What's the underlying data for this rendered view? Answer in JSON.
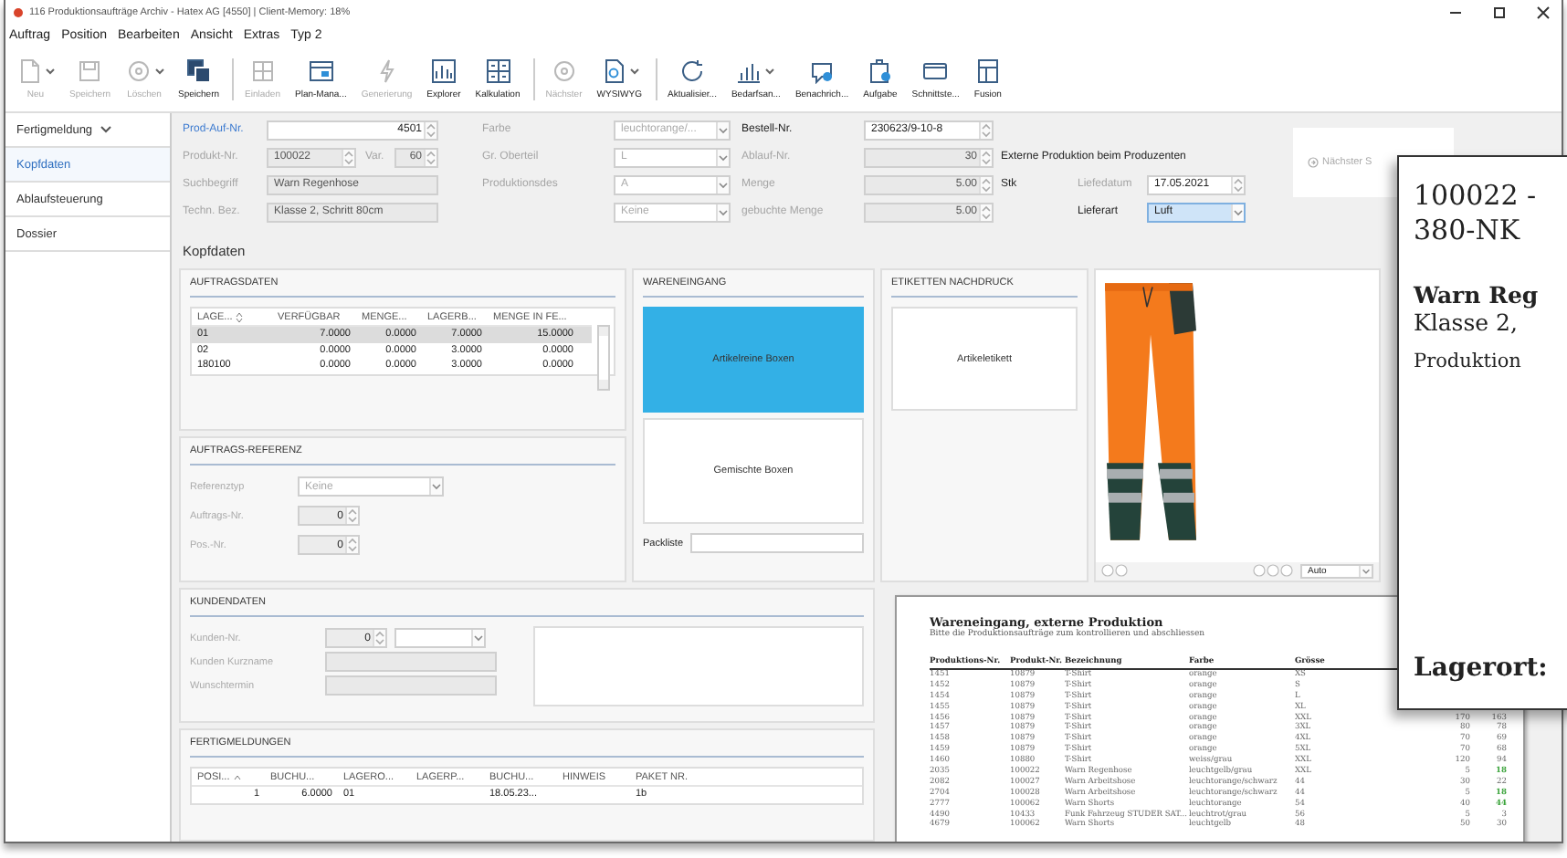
{
  "window": {
    "title": "116 Produktionsaufträge Archiv - Hatex AG [4550] | Client-Memory: 18%"
  },
  "menu": [
    "Auftrag",
    "Position",
    "Bearbeiten",
    "Ansicht",
    "Extras",
    "Typ 2"
  ],
  "toolbar": [
    {
      "label": "Neu",
      "kind": "document",
      "disabled": true,
      "dropdown": true,
      "group_start": false
    },
    {
      "label": "Speichern",
      "kind": "disk",
      "disabled": true,
      "dropdown": false,
      "group_start": false
    },
    {
      "label": "Löschen",
      "kind": "circle",
      "disabled": true,
      "dropdown": true,
      "group_start": false
    },
    {
      "label": "Speichern",
      "kind": "disks",
      "disabled": false,
      "dropdown": false,
      "group_start": false
    },
    {
      "label": "Einladen",
      "kind": "grid",
      "disabled": true,
      "dropdown": false,
      "group_start": true
    },
    {
      "label": "Plan-Mana...",
      "kind": "window",
      "disabled": false,
      "dropdown": false,
      "group_start": false
    },
    {
      "label": "Generierung",
      "kind": "bolt",
      "disabled": true,
      "dropdown": false,
      "group_start": false
    },
    {
      "label": "Explorer",
      "kind": "chart",
      "disabled": false,
      "dropdown": false,
      "group_start": false
    },
    {
      "label": "Kalkulation",
      "kind": "calculator",
      "disabled": false,
      "dropdown": false,
      "group_start": false
    },
    {
      "label": "Nächster",
      "kind": "circle",
      "disabled": true,
      "dropdown": false,
      "group_start": true
    },
    {
      "label": "WYSIWYG",
      "kind": "magnifier",
      "disabled": false,
      "dropdown": true,
      "group_start": false
    },
    {
      "label": "Aktualisier...",
      "kind": "refresh",
      "disabled": false,
      "dropdown": false,
      "group_start": true
    },
    {
      "label": "Bedarfsan...",
      "kind": "bars",
      "disabled": false,
      "dropdown": true,
      "group_start": false
    },
    {
      "label": "Benachrich...",
      "kind": "bubble",
      "disabled": false,
      "dropdown": false,
      "group_start": false
    },
    {
      "label": "Aufgabe",
      "kind": "clipboard",
      "disabled": false,
      "dropdown": false,
      "group_start": false
    },
    {
      "label": "Schnittste...",
      "kind": "card",
      "disabled": false,
      "dropdown": false,
      "group_start": false
    },
    {
      "label": "Fusion",
      "kind": "table",
      "disabled": false,
      "dropdown": false,
      "group_start": false
    }
  ],
  "sidebar": {
    "dropdown": "Fertigmeldung",
    "items": [
      {
        "label": "Kopfdaten",
        "selected": true
      },
      {
        "label": "Ablaufsteuerung",
        "selected": false
      },
      {
        "label": "Dossier",
        "selected": false
      }
    ]
  },
  "header": {
    "rows": [
      {
        "columns": [
          [
            {
              "kind": "link",
              "text": "Prod-Auf-Nr."
            },
            {
              "kind": "spin",
              "text": "4501",
              "numeric": true,
              "disabled": false,
              "readonly": false,
              "focused": false
            }
          ],
          [
            {
              "kind": "label",
              "text": "Farbe",
              "disabled": true
            },
            {
              "kind": "select",
              "text": "leuchtorange/...",
              "numeric": false,
              "disabled": true,
              "readonly": false,
              "focused": false
            }
          ],
          [
            {
              "kind": "label",
              "text": "Bestell-Nr.",
              "disabled": false
            },
            {
              "kind": "spin",
              "text": "230623/9-10-8",
              "numeric": false,
              "disabled": false,
              "readonly": false,
              "focused": false
            }
          ]
        ]
      },
      {
        "columns": [
          [
            {
              "kind": "label",
              "text": "Produkt-Nr.",
              "disabled": true
            },
            {
              "kind": "spin",
              "text": "100022",
              "numeric": false,
              "disabled": false,
              "readonly": true,
              "focused": false
            },
            {
              "kind": "label-short",
              "text": "Var.",
              "disabled": true
            },
            {
              "kind": "spin-narrow",
              "text": "60",
              "numeric": true,
              "disabled": false,
              "readonly": true,
              "focused": false
            }
          ],
          [
            {
              "kind": "label",
              "text": "Gr. Oberteil",
              "disabled": true
            },
            {
              "kind": "select",
              "text": "L",
              "numeric": false,
              "disabled": true,
              "readonly": false,
              "focused": false
            }
          ],
          [
            {
              "kind": "label",
              "text": "Ablauf-Nr.",
              "disabled": true
            },
            {
              "kind": "spin",
              "text": "30",
              "numeric": true,
              "disabled": false,
              "readonly": true,
              "focused": false
            }
          ],
          [
            {
              "kind": "text",
              "text": "Externe Produktion beim Produzenten"
            }
          ]
        ]
      },
      {
        "columns": [
          [
            {
              "kind": "label",
              "text": "Suchbegriff",
              "disabled": true
            },
            {
              "kind": "input",
              "text": "Warn Regenhose",
              "numeric": false,
              "disabled": false,
              "readonly": true,
              "focused": false
            }
          ],
          [
            {
              "kind": "label",
              "text": "Produktionsdes",
              "disabled": true
            },
            {
              "kind": "select",
              "text": "A",
              "numeric": false,
              "disabled": true,
              "readonly": false,
              "focused": false
            }
          ],
          [
            {
              "kind": "label",
              "text": "Menge",
              "disabled": true
            },
            {
              "kind": "spin",
              "text": "5.00",
              "numeric": true,
              "disabled": false,
              "readonly": true,
              "focused": false
            }
          ],
          [
            {
              "kind": "unit",
              "text": "Stk"
            },
            {
              "kind": "label",
              "text": "Liefedatum",
              "disabled": true
            },
            {
              "kind": "spin",
              "text": "17.05.2021",
              "numeric": false,
              "disabled": false,
              "readonly": false,
              "focused": false
            }
          ]
        ]
      },
      {
        "columns": [
          [
            {
              "kind": "label",
              "text": "Techn. Bez.",
              "disabled": true
            },
            {
              "kind": "input",
              "text": "Klasse 2, Schritt 80cm",
              "numeric": false,
              "disabled": false,
              "readonly": true,
              "focused": false
            }
          ],
          [
            {
              "kind": "select",
              "text": "Keine",
              "numeric": false,
              "disabled": true,
              "readonly": false,
              "focused": false
            }
          ],
          [
            {
              "kind": "label",
              "text": "gebuchte Menge",
              "disabled": true
            },
            {
              "kind": "spin",
              "text": "5.00",
              "numeric": true,
              "disabled": false,
              "readonly": true,
              "focused": false
            }
          ],
          [
            {
              "kind": "label",
              "text": "Lieferart",
              "disabled": false
            },
            {
              "kind": "select",
              "text": "Luft",
              "numeric": false,
              "disabled": false,
              "readonly": false,
              "focused": true
            }
          ]
        ]
      }
    ],
    "next_button": {
      "label": "Nächster S",
      "disabled": true
    }
  },
  "section_title": "Kopfdaten",
  "auftragsdaten": {
    "title": "AUFTRAGSDATEN",
    "columns": [
      {
        "label": "LAGE...",
        "sortable": true
      },
      {
        "label": "VERFÜGBAR"
      },
      {
        "label": "MENGE..."
      },
      {
        "label": "LAGERB..."
      },
      {
        "label": "MENGE IN FE..."
      }
    ],
    "rows": [
      {
        "cells": [
          "01",
          "7.0000",
          "0.0000",
          "7.0000",
          "15.0000"
        ],
        "selected": true
      },
      {
        "cells": [
          "02",
          "0.0000",
          "0.0000",
          "3.0000",
          "0.0000"
        ],
        "selected": false
      },
      {
        "cells": [
          "180100",
          "0.0000",
          "0.0000",
          "3.0000",
          "0.0000"
        ],
        "selected": false
      }
    ]
  },
  "wareneingang": {
    "title": "WARENEINGANG",
    "buttons": [
      {
        "label": "Artikelreine Boxen",
        "selected": true
      },
      {
        "label": "Gemischte Boxen",
        "selected": false
      }
    ],
    "packliste_label": "Packliste"
  },
  "etiketten": {
    "title": "ETIKETTEN NACHDRUCK",
    "button": "Artikeletikett"
  },
  "image_panel": {
    "kind": "picture",
    "zoom_mode": "Auto"
  },
  "auftrags_referenz": {
    "title": "AUFTRAGS-REFERENZ",
    "rows": [
      {
        "label": "Referenztyp",
        "fields": [
          {
            "kind": "select",
            "text": "Keine"
          }
        ]
      },
      {
        "label": "Auftrags-Nr.",
        "fields": [
          {
            "kind": "spin",
            "text": "0"
          }
        ]
      },
      {
        "label": "Pos.-Nr.",
        "fields": [
          {
            "kind": "spin",
            "text": "0"
          }
        ]
      }
    ]
  },
  "kundendaten": {
    "title": "KUNDENDATEN",
    "rows": [
      {
        "label": "Kunden-Nr.",
        "fields": [
          {
            "kind": "spin",
            "text": "0"
          },
          {
            "kind": "select"
          }
        ]
      },
      {
        "label": "Kunden Kurzname",
        "fields": [
          {
            "kind": "input"
          }
        ]
      },
      {
        "label": "Wunschtermin",
        "fields": [
          {
            "kind": "input"
          }
        ]
      }
    ]
  },
  "fertigmeldungen": {
    "title": "FERTIGMELDUNGEN",
    "columns": [
      {
        "label": "POSI...",
        "ascending": true
      },
      {
        "label": "BUCHU..."
      },
      {
        "label": "LAGERO..."
      },
      {
        "label": "LAGERP..."
      },
      {
        "label": "BUCHU..."
      },
      {
        "label": "HINWEIS"
      },
      {
        "label": "PAKET NR."
      }
    ],
    "rows": [
      {
        "cells": [
          "1",
          "6.0000",
          "01",
          null,
          "18.05.23...",
          null,
          "1b"
        ]
      }
    ]
  },
  "document": {
    "title": "Wareneingang, externe Produktion",
    "subtitle": "Bitte die Produktionsaufträge zum kontrollieren und abschliessen",
    "columns": [
      "Produktions-Nr.",
      "Produkt-Nr.",
      "Bezeichnung",
      "Farbe",
      "Grösse"
    ],
    "rows": [
      {
        "cells": [
          "1451",
          "10879",
          "T-Shirt",
          "orange",
          "XS"
        ]
      },
      {
        "cells": [
          "1452",
          "10879",
          "T-Shirt",
          "orange",
          "S"
        ]
      },
      {
        "cells": [
          "1454",
          "10879",
          "T-Shirt",
          "orange",
          "L"
        ]
      },
      {
        "cells": [
          "1455",
          "10879",
          "T-Shirt",
          "orange",
          "XL"
        ]
      },
      {
        "cells": [
          "1456",
          "10879",
          "T-Shirt",
          "orange",
          "XXL"
        ],
        "column_6": "170",
        "column_7": "163",
        "highlight": false
      },
      {
        "cells": [
          "1457",
          "10879",
          "T-Shirt",
          "orange",
          "3XL"
        ],
        "column_6": "80",
        "column_7": "78",
        "highlight": false
      },
      {
        "cells": [
          "1458",
          "10879",
          "T-Shirt",
          "orange",
          "4XL"
        ],
        "column_6": "70",
        "column_7": "69",
        "highlight": false
      },
      {
        "cells": [
          "1459",
          "10879",
          "T-Shirt",
          "orange",
          "5XL"
        ],
        "column_6": "70",
        "column_7": "68",
        "highlight": false
      },
      {
        "cells": [
          "1460",
          "10880",
          "T-Shirt",
          "weiss/grau",
          "XXL"
        ],
        "column_6": "120",
        "column_7": "94",
        "highlight": false
      },
      {
        "cells": [
          "2035",
          "100022",
          "Warn Regenhose",
          "leuchtgelb/grau",
          "XXL"
        ],
        "column_6": "5",
        "column_7": "18",
        "highlight": true
      },
      {
        "cells": [
          "2082",
          "100027",
          "Warn Arbeitshose",
          "leuchtorange/schwarz",
          "44"
        ],
        "column_6": "30",
        "column_7": "22",
        "highlight": false
      },
      {
        "cells": [
          "2704",
          "100028",
          "Warn Arbeitshose",
          "leuchtorange/schwarz",
          "44"
        ],
        "column_6": "5",
        "column_7": "18",
        "highlight": true
      },
      {
        "cells": [
          "2777",
          "100062",
          "Warn Shorts",
          "leuchtorange",
          "54"
        ],
        "column_6": "40",
        "column_7": "44",
        "highlight": true
      },
      {
        "cells": [
          "4490",
          "10433",
          "Funk Fahrzeug STUDER SAT...",
          "leuchtrot/grau",
          "56"
        ],
        "column_6": "5",
        "column_7": "3",
        "highlight": false
      },
      {
        "cells": [
          "4679",
          "100062",
          "Warn Shorts",
          "leuchtgelb",
          "48"
        ],
        "column_6": "50",
        "column_7": "30",
        "highlight": false
      }
    ]
  },
  "label_card": {
    "lines": [
      {
        "kind": "code",
        "text": "100022 -"
      },
      {
        "kind": "code",
        "text": "380-NK"
      },
      {
        "kind": "name",
        "text": "Warn Reg"
      },
      {
        "kind": "detail",
        "text": "Klasse 2,"
      },
      {
        "kind": "note",
        "text": "Produktion"
      },
      {
        "kind": "footer",
        "text": "Lagerort:"
      }
    ]
  }
}
